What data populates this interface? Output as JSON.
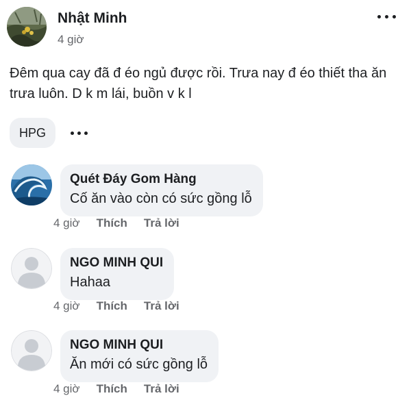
{
  "post": {
    "author": "Nhật Minh",
    "time": "4 giờ",
    "text": "Đêm qua cay đã đ éo ngủ được rồi. Trưa nay đ éo thiết tha ăn trưa luôn. D k m lái, buồn v k l",
    "tag": "HPG"
  },
  "comments": [
    {
      "name": "Quét Đáy Gom Hàng",
      "text": "Cố ăn vào còn có sức gồng lỗ",
      "time": "4 giờ",
      "like": "Thích",
      "reply": "Trả lời"
    },
    {
      "name": "NGO MINH QUI",
      "text": "Hahaa",
      "time": "4 giờ",
      "like": "Thích",
      "reply": "Trả lời"
    },
    {
      "name": "NGO MINH QUI",
      "text": "Ăn mới có sức gồng lỗ",
      "time": "4 giờ",
      "like": "Thích",
      "reply": "Trả lời"
    }
  ],
  "icons": {
    "post_more": "more-horizontal-icon",
    "tag_more": "more-horizontal-icon",
    "default_avatar": "person-silhouette-icon",
    "wave_avatar": "ocean-wave-icon"
  },
  "colors": {
    "text": "#1c1e21",
    "secondary": "#65676b",
    "bubble": "#f0f2f5"
  }
}
